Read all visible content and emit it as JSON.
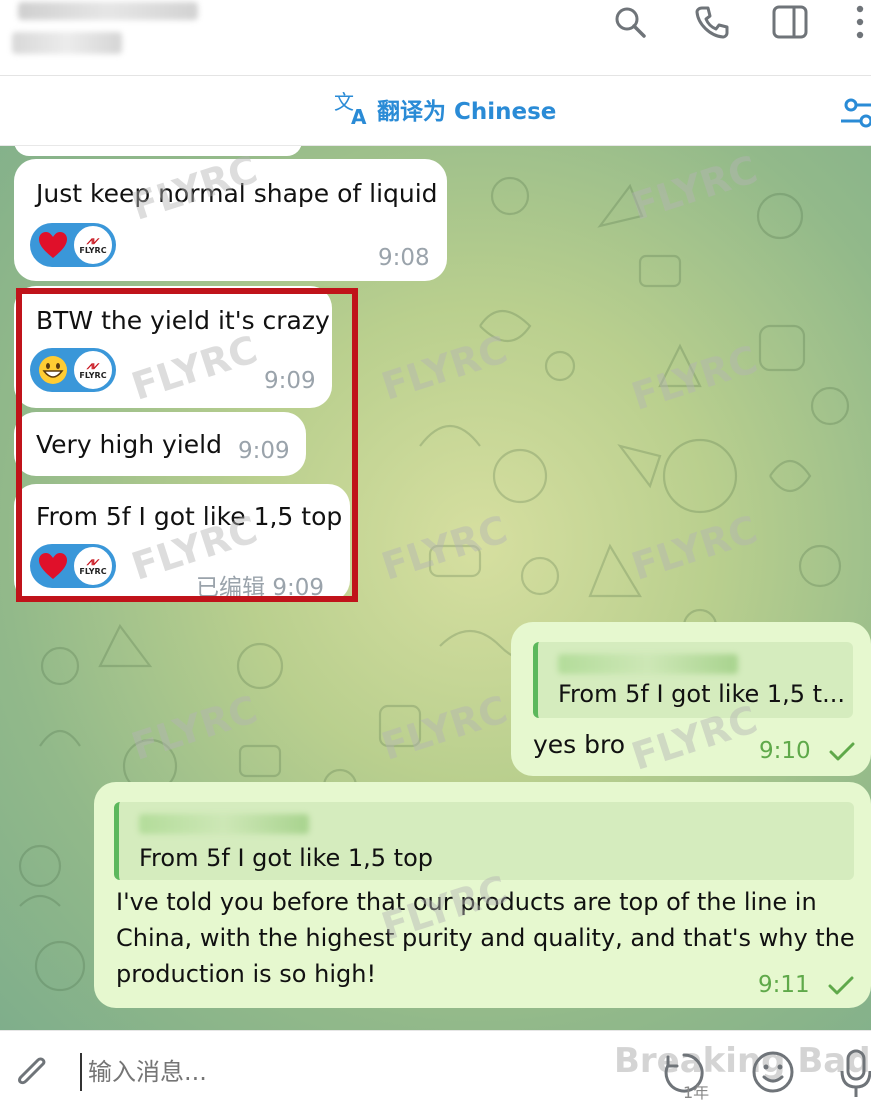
{
  "translate_bar": {
    "label": "翻译为 Chinese"
  },
  "messages": {
    "m1": {
      "text": "Just keep normal shape of liquid",
      "time": "9:08",
      "reaction_emoji": "heart",
      "reactor_logo": "FLYRC"
    },
    "m2": {
      "text": "BTW the yield it's crazy",
      "time": "9:09",
      "reaction_emoji": "grinning-face",
      "reactor_logo": "FLYRC"
    },
    "m3": {
      "text": "Very high yield",
      "time": "9:09"
    },
    "m4": {
      "text": "From 5f I got like 1,5 top",
      "time": "9:09",
      "edited_label": "已编辑",
      "reaction_emoji": "heart",
      "reactor_logo": "FLYRC"
    },
    "m5": {
      "quote_text": "From 5f I got like 1,5 t...",
      "text": "yes bro",
      "time": "9:10",
      "status": "sent-check"
    },
    "m6": {
      "quote_text": "From 5f I got like 1,5 top",
      "text_lines": [
        "I've told you before that our products are top of the line in",
        "China, with the highest purity and quality, and that's why the",
        "production is so high!"
      ],
      "time": "9:11",
      "status": "sent-check"
    }
  },
  "watermark_text": "FLYRC",
  "input": {
    "placeholder": "输入消息...",
    "overlay_mark": "Breaking Bad",
    "timer_label": "1年"
  },
  "colors": {
    "accent": "#2a8bd6",
    "highlight": "#c0131a",
    "outgoing_bubble": "#e6f8cf",
    "reaction_pill": "#3a97d9",
    "check": "#5fa94a"
  }
}
